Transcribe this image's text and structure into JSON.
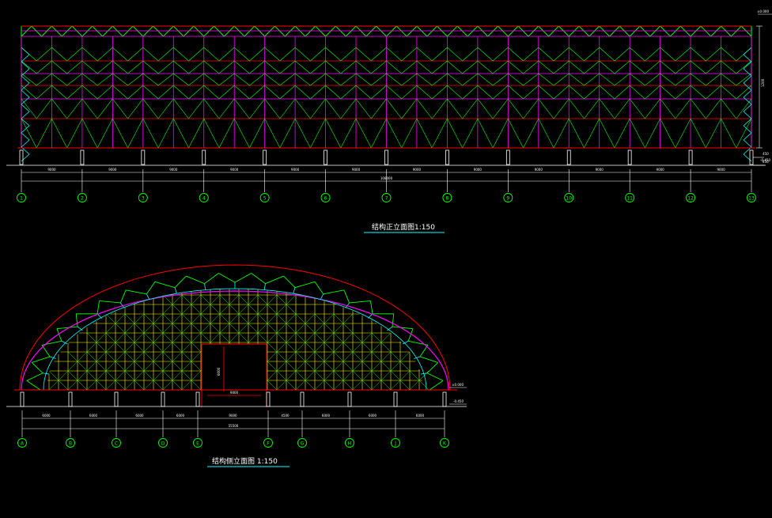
{
  "colors": {
    "background": "#000000",
    "truss_top": "#00ff00",
    "truss_secondary": "#ffff00",
    "truss_web": "#ff00ff",
    "truss_bracing": "#00ffff",
    "arch_outline": "#ff0000",
    "dimension": "#ffffff",
    "grid_bubble": "#00ff00",
    "underline": "#00ffff"
  },
  "front_elevation": {
    "title": "结构正立面图1:150",
    "bays": 12,
    "grid_labels": [
      "1",
      "2",
      "3",
      "4",
      "5",
      "6",
      "7",
      "8",
      "9",
      "10",
      "11",
      "12",
      "13"
    ],
    "bay_dims": [
      "9000",
      "9000",
      "9000",
      "9000",
      "9000",
      "9000",
      "9000",
      "9000",
      "9000",
      "9000",
      "9000",
      "9000"
    ],
    "total_dim": "108000",
    "height_dim": "1200",
    "level_top": "±0.000",
    "level_bottom": "-0.450",
    "side_dims": [
      "450",
      "450"
    ]
  },
  "side_elevation": {
    "title": "结构侧立面图 1:150",
    "grid_labels": [
      "A",
      "B",
      "C",
      "D",
      "E",
      "F",
      "G",
      "H",
      "J",
      "K"
    ],
    "bay_dims": [
      "6000",
      "6000",
      "6000",
      "6000",
      "9000",
      "4500",
      "6000",
      "6000",
      "6000"
    ],
    "total_dim": "55500",
    "opening_height": "6000",
    "opening_width": "9000",
    "level_top": "±0.000",
    "level_bottom": "-0.450"
  }
}
